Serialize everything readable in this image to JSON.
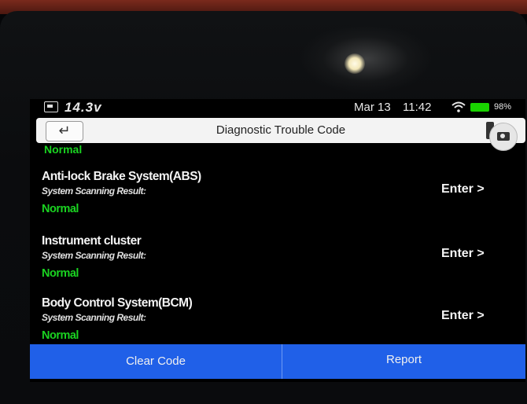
{
  "status_bar": {
    "voltage": "14.3v",
    "date": "Mar 13",
    "time": "11:42",
    "battery_percent": "98%",
    "icons": [
      "car-battery-icon",
      "wifi-icon",
      "battery-icon"
    ]
  },
  "header": {
    "title": "Diagnostic Trouble Code",
    "back_icon": "↵"
  },
  "list": {
    "partial_top_status": "Normal",
    "items": [
      {
        "name": "Anti-lock Brake System(ABS)",
        "sub": "System Scanning Result:",
        "status": "Normal",
        "action": "Enter >"
      },
      {
        "name": "Instrument cluster",
        "sub": "System Scanning Result:",
        "status": "Normal",
        "action": "Enter >"
      },
      {
        "name": "Body Control System(BCM)",
        "sub": "System Scanning Result:",
        "status": "Normal",
        "action": "Enter >"
      }
    ]
  },
  "footer": {
    "clear_code": "Clear Code",
    "report": "Report"
  },
  "colors": {
    "status_green": "#1ad321",
    "footer_blue": "#2060e8",
    "titlebar_bg": "#f3f3f3"
  }
}
